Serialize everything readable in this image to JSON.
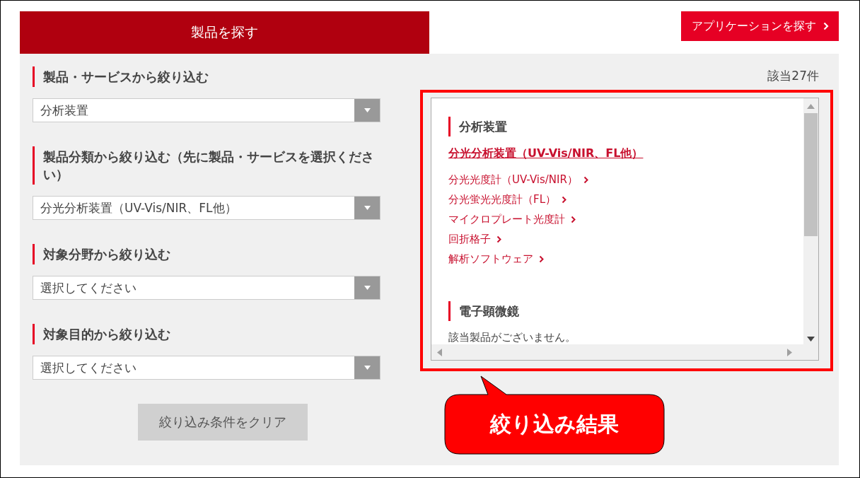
{
  "tabs": [
    {
      "label": "製品を探す",
      "selected": true
    }
  ],
  "app_search_button": {
    "label": "アプリケーションを探す"
  },
  "filters": [
    {
      "label": "製品・サービスから絞り込む",
      "value": "分析装置"
    },
    {
      "label": "製品分類から絞り込む（先に製品・サービスを選択ください）",
      "value": "分光分析装置（UV-Vis/NIR、FL他）"
    },
    {
      "label": "対象分野から絞り込む",
      "value": "選択してください"
    },
    {
      "label": "対象目的から絞り込む",
      "value": "選択してください"
    }
  ],
  "clear_button": {
    "label": "絞り込み条件をクリア"
  },
  "results": {
    "count": "該当27件",
    "sections": [
      {
        "title": "分析装置",
        "category_link": "分光分析装置（UV-Vis/NIR、FL他）",
        "items": [
          "分光光度計（UV-Vis/NIR）",
          "分光蛍光光度計（FL）",
          "マイクロプレート光度計",
          "回折格子",
          "解析ソフトウェア"
        ]
      },
      {
        "title": "電子顕微鏡",
        "message": "該当製品がございません。"
      }
    ]
  },
  "callout": {
    "text": "絞り込み結果"
  }
}
